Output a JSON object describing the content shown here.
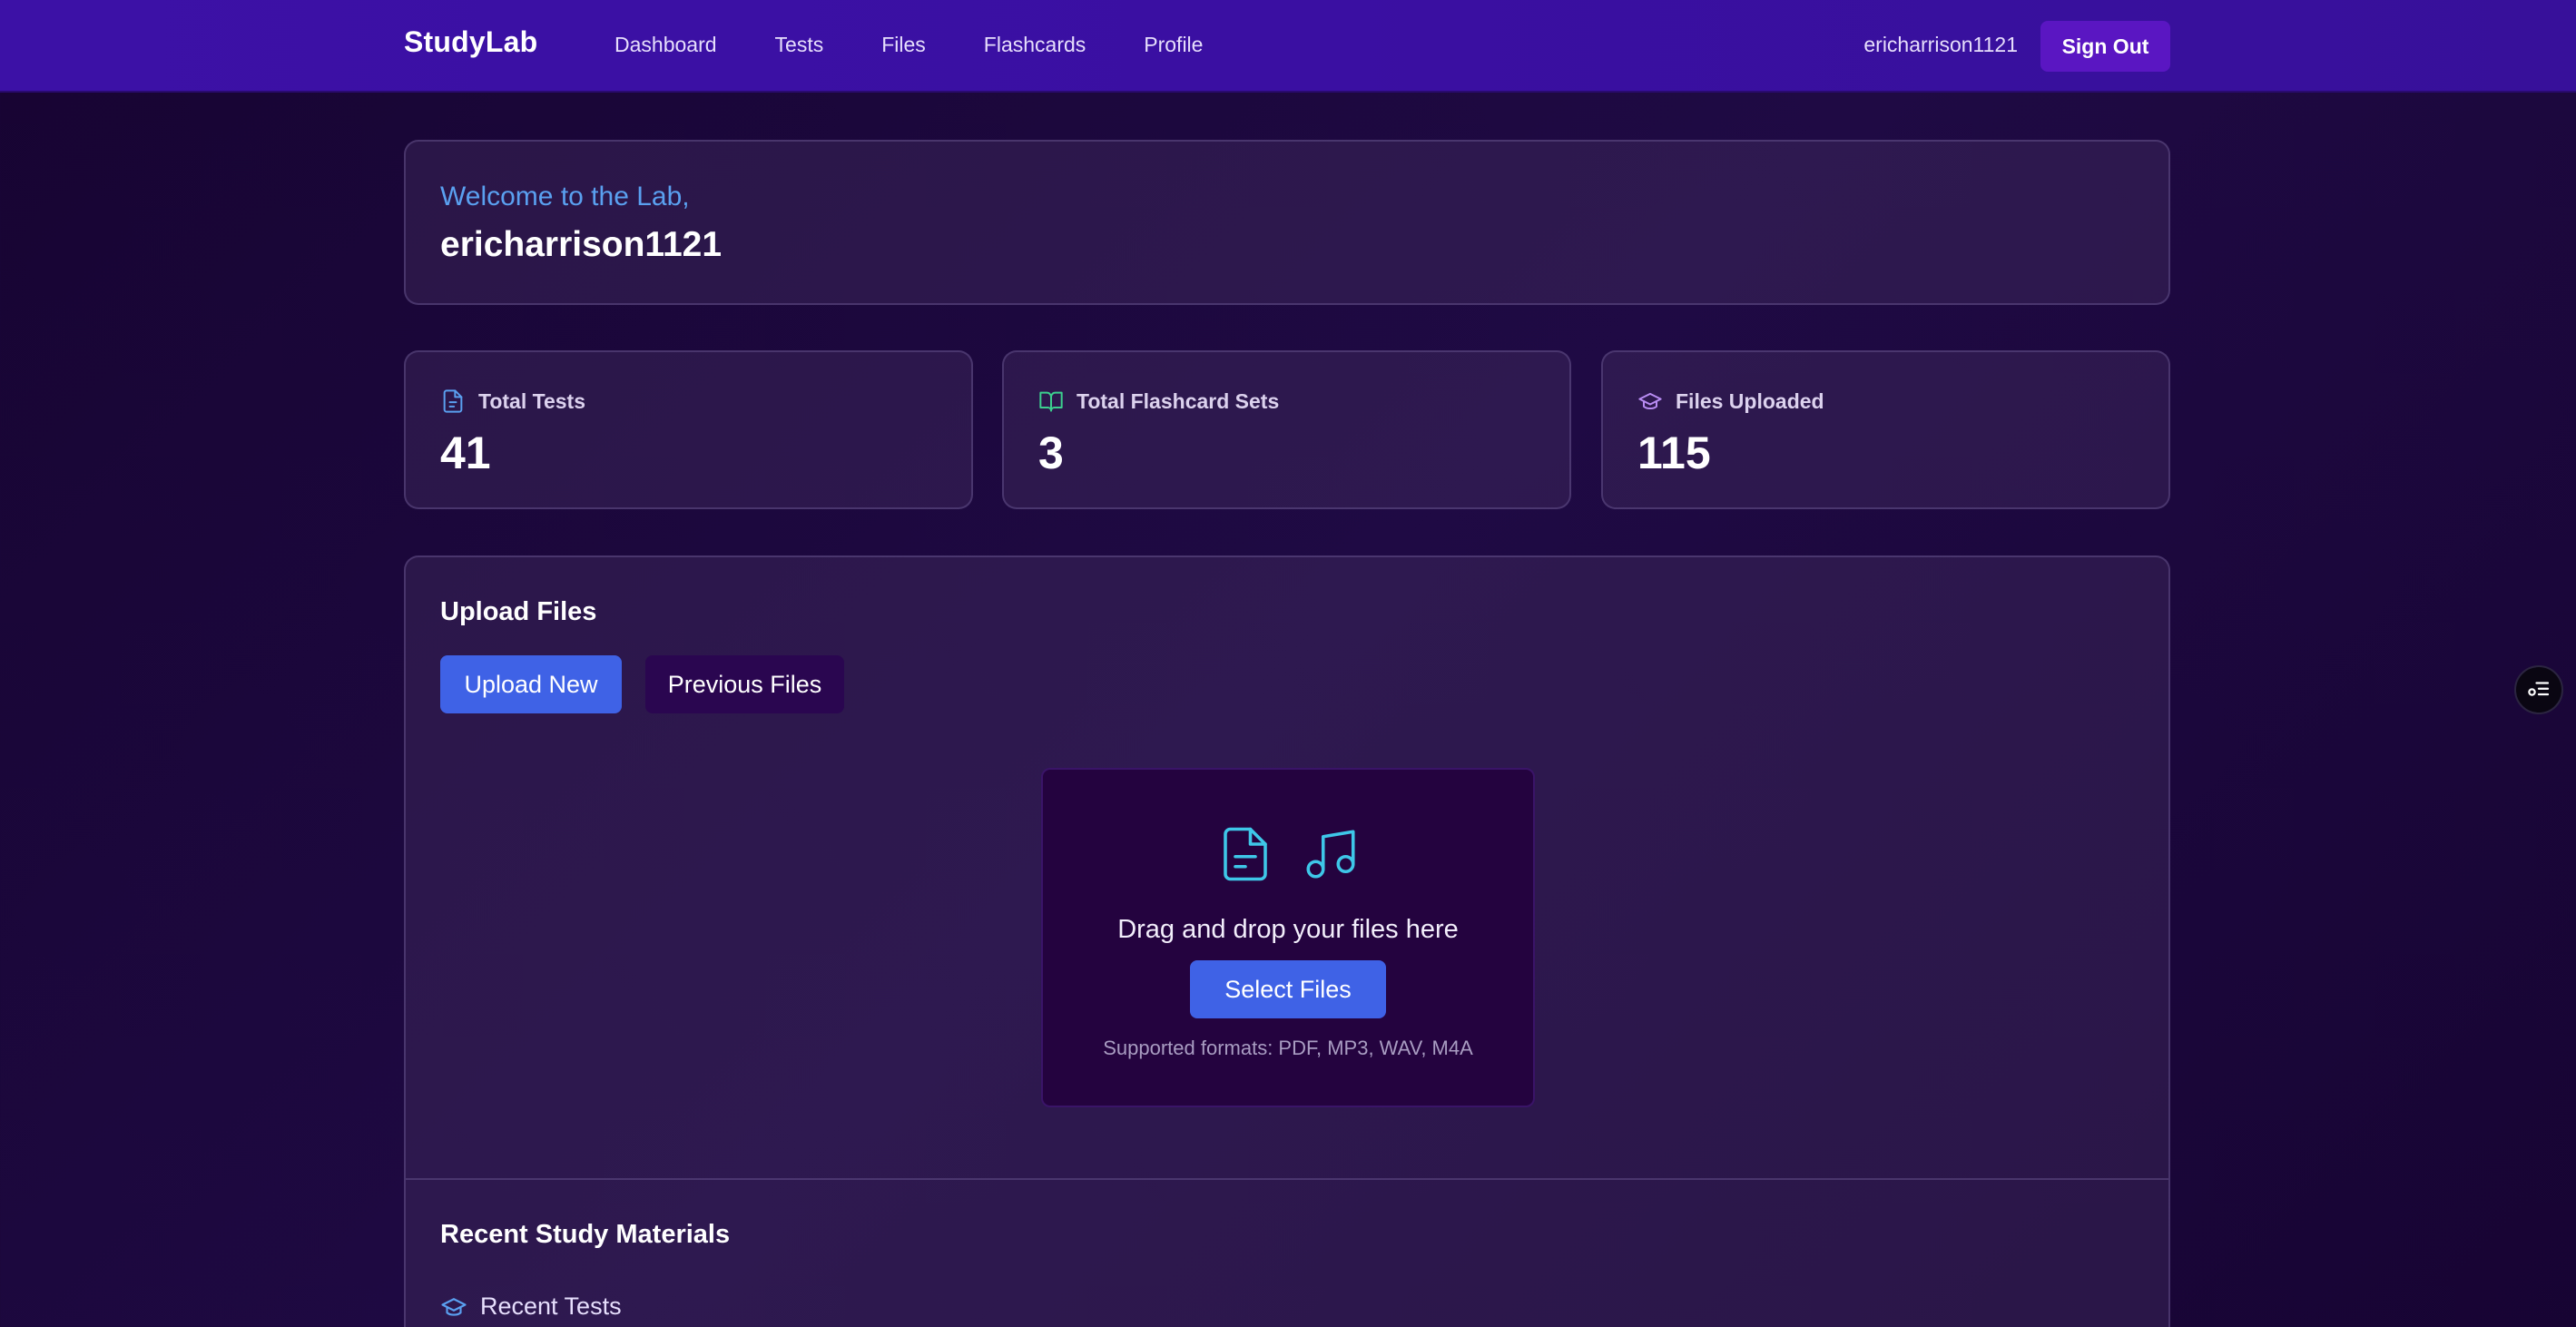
{
  "nav": {
    "brand": "StudyLab",
    "links": [
      "Dashboard",
      "Tests",
      "Files",
      "Flashcards",
      "Profile"
    ],
    "username": "ericharrison1121",
    "signout_label": "Sign Out"
  },
  "welcome": {
    "greeting": "Welcome to the Lab,",
    "username": "ericharrison1121"
  },
  "stats": [
    {
      "label": "Total Tests",
      "value": "41",
      "icon": "document-icon",
      "color": "#5aa0f0"
    },
    {
      "label": "Total Flashcard Sets",
      "value": "3",
      "icon": "book-open-icon",
      "color": "#3ccf8e"
    },
    {
      "label": "Files Uploaded",
      "value": "115",
      "icon": "graduation-cap-icon",
      "color": "#b98cf3"
    }
  ],
  "upload": {
    "title": "Upload Files",
    "upload_new_label": "Upload New",
    "previous_files_label": "Previous Files",
    "dropzone_text": "Drag and drop your files here",
    "select_files_label": "Select Files",
    "formats_text": "Supported formats: PDF, MP3, WAV, M4A"
  },
  "recent": {
    "title": "Recent Study Materials",
    "tests_label": "Recent Tests"
  },
  "colors": {
    "accent": "#3f62e6",
    "nav_bg": "#3c11a6",
    "icon_cyan": "#3ec7e8"
  }
}
